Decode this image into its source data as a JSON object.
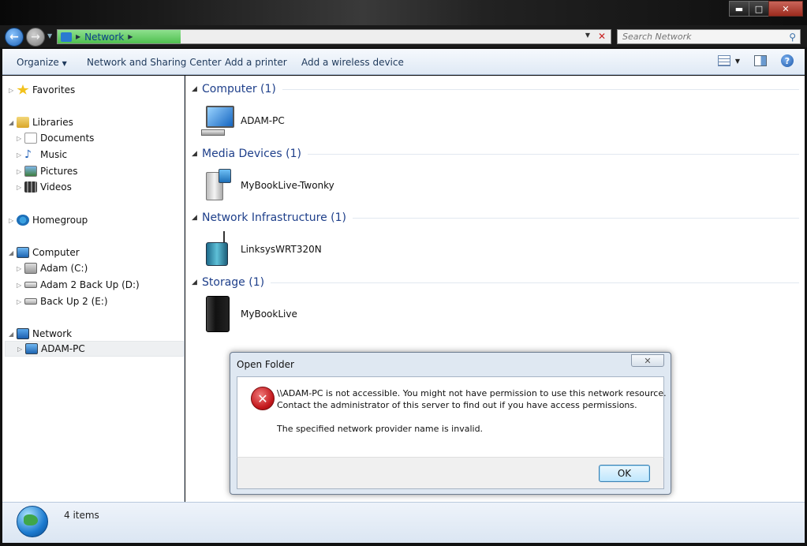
{
  "window": {
    "minimize_glyph": "▬",
    "maximize_glyph": "□",
    "close_glyph": "✕"
  },
  "address": {
    "crumb": "Network",
    "search_placeholder": "Search Network"
  },
  "commands": {
    "organize": "Organize",
    "network_sharing": "Network and Sharing Center",
    "add_printer": "Add a printer",
    "add_wireless": "Add a wireless device",
    "help_glyph": "?"
  },
  "nav": {
    "favorites": "Favorites",
    "libraries": "Libraries",
    "documents": "Documents",
    "music": "Music",
    "pictures": "Pictures",
    "videos": "Videos",
    "homegroup": "Homegroup",
    "computer": "Computer",
    "drive_c": "Adam (C:)",
    "drive_d": "Adam 2 Back Up (D:)",
    "drive_e": "Back Up 2 (E:)",
    "network": "Network",
    "adam_pc": "ADAM-PC"
  },
  "groups": {
    "computer": {
      "title": "Computer (1)",
      "device": "ADAM-PC"
    },
    "media": {
      "title": "Media Devices (1)",
      "device": "MyBookLive-Twonky"
    },
    "infra": {
      "title": "Network Infrastructure (1)",
      "device": "LinksysWRT320N"
    },
    "storage": {
      "title": "Storage (1)",
      "device": "MyBookLive"
    }
  },
  "status": {
    "items": "4 items"
  },
  "dialog": {
    "title": "Open Folder",
    "close_glyph": "✕",
    "line1": "\\\\ADAM-PC is not accessible. You might not have permission to use this network resource.",
    "line2": "Contact the administrator of this server to find out if you have access permissions.",
    "line3": "The specified network provider name is invalid.",
    "ok": "OK",
    "error_glyph": "✕"
  }
}
